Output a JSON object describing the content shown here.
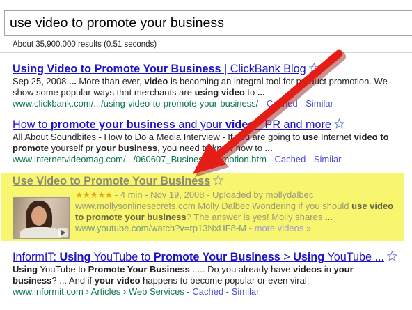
{
  "search": {
    "query": "use video to promote your business"
  },
  "stats": "About 35,900,000 results (0.51 seconds)",
  "results": [
    {
      "title": [
        {
          "t": "Using Video to Promote Your Business",
          "b": true
        },
        {
          "t": " | ClickBank Blog",
          "b": false
        }
      ],
      "snippet": [
        [
          {
            "t": "Sep 25, 2008 ",
            "b": false
          },
          {
            "t": "...",
            "b": true
          },
          {
            "t": " More than ever, ",
            "b": false
          },
          {
            "t": "video",
            "b": true
          },
          {
            "t": " is becoming an integral tool for product promotion. We",
            "b": false
          }
        ],
        [
          {
            "t": "show some popular ways that merchants are ",
            "b": false
          },
          {
            "t": "using video",
            "b": true
          },
          {
            "t": " to ",
            "b": false
          },
          {
            "t": "...",
            "b": true
          }
        ]
      ],
      "url": "www.clickbank.com/.../using-video-to-promote-your-business/",
      "cached": "Cached",
      "similar": "Similar"
    },
    {
      "title": [
        {
          "t": "How to ",
          "b": false
        },
        {
          "t": "promote your business",
          "b": true
        },
        {
          "t": " and your ",
          "b": false
        },
        {
          "t": "video",
          "b": true
        },
        {
          "t": " - PR and more",
          "b": false
        }
      ],
      "snippet": [
        [
          {
            "t": "All About Soundbites - How to Do a Media Interview - If you are going to ",
            "b": false
          },
          {
            "t": "use",
            "b": true
          },
          {
            "t": " Internet ",
            "b": false
          },
          {
            "t": "video to",
            "b": true
          }
        ],
        [
          {
            "t": "promote",
            "b": true
          },
          {
            "t": " yourself pr ",
            "b": false
          },
          {
            "t": "your business",
            "b": true
          },
          {
            "t": ", you need to know how to ",
            "b": false
          },
          {
            "t": "...",
            "b": true
          }
        ]
      ],
      "url": "www.internetvideomag.com/.../060607_BusinessPromotion.htm",
      "cached": "Cached",
      "similar": "Similar"
    },
    {
      "title": [
        {
          "t": "InformIT: ",
          "b": false
        },
        {
          "t": "Using",
          "b": true
        },
        {
          "t": " YouTube to ",
          "b": false
        },
        {
          "t": "Promote Your Business",
          "b": true
        },
        {
          "t": " > ",
          "b": false
        },
        {
          "t": "Using",
          "b": true
        },
        {
          "t": " YouTube ...",
          "b": false
        }
      ],
      "snippet": [
        [
          {
            "t": "Using",
            "b": true
          },
          {
            "t": " YouTube to ",
            "b": false
          },
          {
            "t": "Promote Your Business",
            "b": true
          },
          {
            "t": " ..... Do you already have ",
            "b": false
          },
          {
            "t": "videos",
            "b": true
          },
          {
            "t": " in ",
            "b": false
          },
          {
            "t": "your",
            "b": true
          }
        ],
        [
          {
            "t": "business",
            "b": true
          },
          {
            "t": "? ... And if ",
            "b": false
          },
          {
            "t": "your video",
            "b": true
          },
          {
            "t": " happens to become popular or even viral, ",
            "b": false
          }
        ]
      ],
      "url": "www.informit.com › Articles › Web Services",
      "cached": "Cached",
      "similar": "Similar"
    }
  ],
  "video_result": {
    "title": "Use Video to Promote Your Business",
    "rating_stars": 5,
    "meta": " - 4 min - Nov 19, 2008 - Uploaded by mollydalbec",
    "snippet": [
      [
        {
          "t": "www.mollysonlinesecrets.com Molly Dalbec Wondering if you should ",
          "b": false
        },
        {
          "t": "use video",
          "b": true
        }
      ],
      [
        {
          "t": "to promote your business",
          "b": true
        },
        {
          "t": "? The answer is yes! Molly shares ",
          "b": false
        },
        {
          "t": "...",
          "b": true
        }
      ]
    ],
    "url": "www.youtube.com/watch?v=rp13NxHF8-M",
    "more_videos": "more videos »"
  },
  "colors": {
    "link": "#1a13c8",
    "url_green": "#0e774a",
    "highlight": "#f8f56e",
    "arrow_red": "#e41e17"
  },
  "icons": [
    "star-icon",
    "video-thumbnail",
    "play-icon",
    "red-arrow"
  ]
}
